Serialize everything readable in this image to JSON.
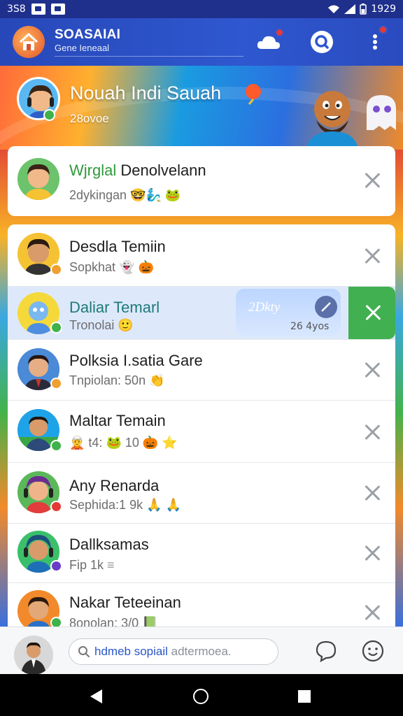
{
  "status_bar": {
    "left_text": "3S8",
    "right_text": "1929"
  },
  "header": {
    "title": "SOASAIAI",
    "subtitle": "Gene Ieneaal"
  },
  "hero": {
    "name": "Nouah Indi Sauah",
    "sub": "28ovoe"
  },
  "featured": {
    "name_green": "Wjrglal",
    "name_rest": " Denolvelann",
    "sub": "2dykingan",
    "emojis": "🤓🧞‍♂️ 🐸"
  },
  "rows": [
    {
      "name": "Desdla Temiin",
      "sub": "Sopkhat",
      "emojis": "👻 🎃",
      "presence_color": "#f0a030"
    },
    {
      "name": "Daliar Temarl",
      "sub": "Tronolai",
      "emojis": "🙂",
      "presence_color": "#3fb24a",
      "highlight": true
    },
    {
      "name": "Polksia I.satia Gare",
      "sub": "Tnpiolan: 50n",
      "emojis": "👏",
      "presence_color": "#f0a030"
    },
    {
      "name": "Maltar Temain",
      "sub": "🧝 t4: ",
      "emojis": "🐸 10 🎃 ⭐",
      "presence_color": "#3fb24a"
    },
    {
      "name": "Any Renarda",
      "sub": "Sephida:1 9k",
      "emojis": "🙏 🙏",
      "presence_color": "#e53935"
    },
    {
      "name": "Dallksamas",
      "sub": "Fip 1k",
      "emojis": "≡",
      "presence_color": "#6a3cc8"
    },
    {
      "name": "Nakar Teteeinan",
      "sub": "8onolan: 3/0",
      "emojis": "📗",
      "presence_color": "#3fb24a"
    }
  ],
  "swipe": {
    "chip_label": "2Dkty",
    "chip_time": "26 4yos"
  },
  "bottom": {
    "search_blue": "hdmeb sopiail",
    "search_grey": " adtermoea."
  }
}
